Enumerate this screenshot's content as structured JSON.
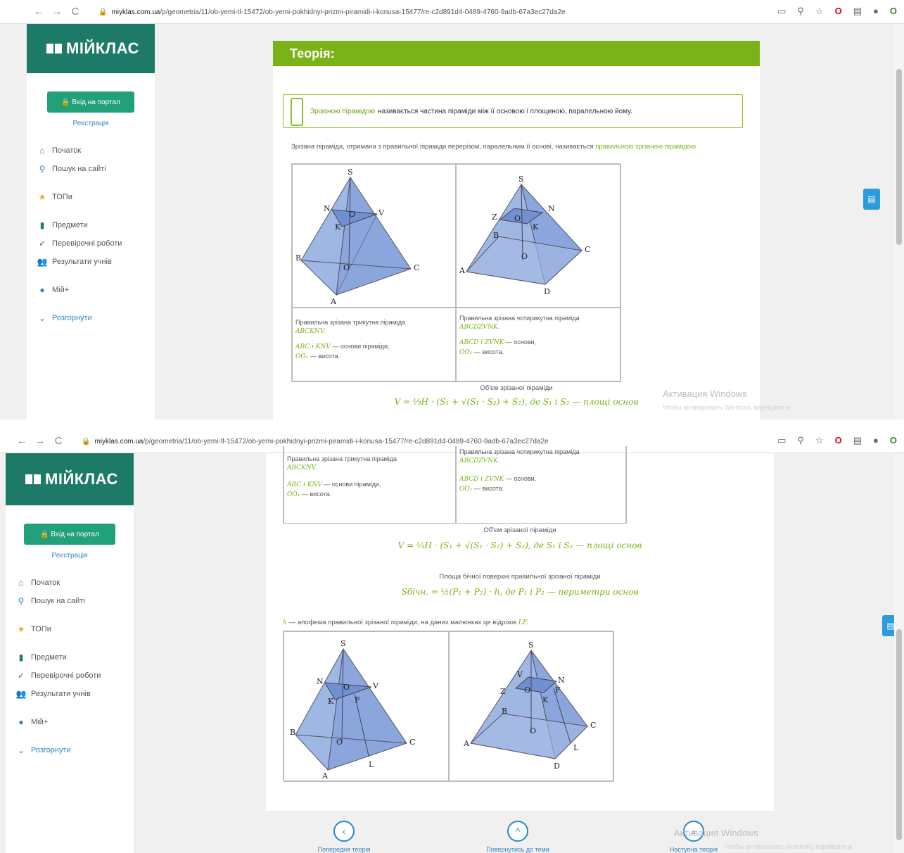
{
  "browser": {
    "url_host": "miyklas.com.ua",
    "url_path": "/p/geometria/11/ob-yemi-tl-15472/ob-yemi-pokhidnyi-prizmi-piramidi-i-konusa-15477/re-c2d891d4-0489-4760-9adb-67a3ec27da2e"
  },
  "sidebar": {
    "logo": "МІЙКЛАС",
    "login": "Вхід на портал",
    "register": "Реєстрація",
    "items": [
      "Початок",
      "Пошук на сайті",
      "ТОПи",
      "Предмети",
      "Перевірочні роботи",
      "Результати учнів",
      "Мій+",
      "Розгорнути"
    ]
  },
  "theory": {
    "title": "Теорія:",
    "def_term": "Зрізаною пірамідою",
    "def_text": "називається частина піраміди між її основою і площиною, паралельною йому.",
    "para1": "Зрізана піраміда, отримана з правильної піраміди перерізом, паралельним її основі, називається",
    "para1_link": "правильною зрізаною пірамідою",
    "cell1_text": "Правильна зрізана трикутна піраміда",
    "cell1_math": "ABCKNV.",
    "cell1_bases_math": "ABC і KNV",
    "cell1_bases": "— основи піраміди,",
    "cell1_height_math": "OO₁",
    "cell1_height": "— висота.",
    "cell2_text": "Правильна зрізана чотирикутна піраміда",
    "cell2_math": "ABCDZVNK.",
    "cell2_bases_math": "ABCD і ZVNK",
    "cell2_bases": "— основи,",
    "cell2_height_math": "OO₁",
    "cell2_height": "— висота.",
    "volume_label": "Об'єм зрізаної піраміди",
    "volume_formula": "V = ⅓H · (S₁ + √(S₁ · S₂) + S₂), де S₁ і S₂ — площі основ",
    "lateral_label": "Площа бічної поверхні правильної зрізаної піраміди",
    "lateral_formula": "Sбічн. = ½(P₁ + P₂) · h, де P₁ і P₂ — периметри основ",
    "apothem_math": "h",
    "apothem_text": "— апофема правильної зрізаної піраміди, на даних малюнках це відрізок",
    "apothem_seg": "LF."
  },
  "footer": {
    "prev": "Попередня теорія",
    "back": "Повернутись до теми",
    "next": "Наступна теорія"
  },
  "watermark": {
    "title": "Активация Windows",
    "sub": "Чтобы активировать Windows, перейдите в"
  },
  "colors": {
    "accent_green": "#7ab317",
    "logo_green": "#1d7a66",
    "button_green": "#21a07a",
    "link_blue": "#2c86c6"
  }
}
